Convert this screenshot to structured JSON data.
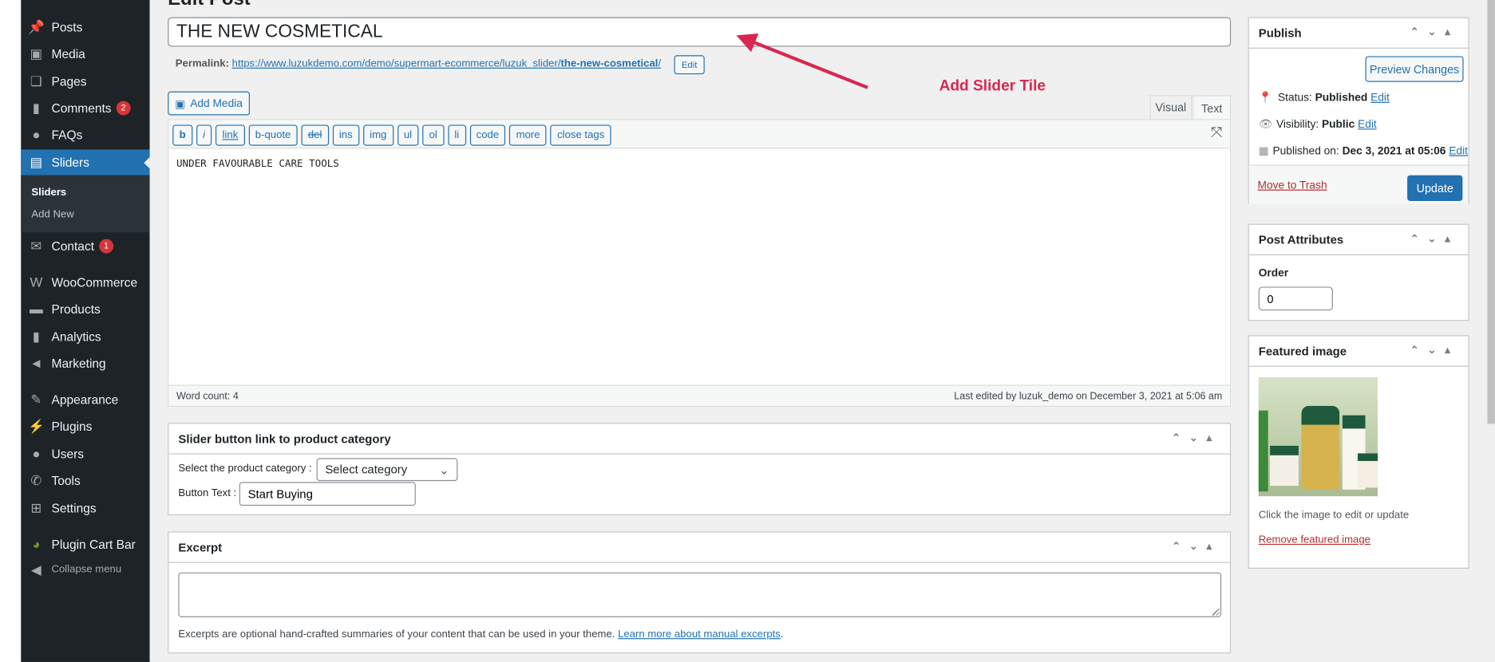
{
  "sidebar": {
    "items": [
      {
        "label": "Posts",
        "icon": "pin-icon"
      },
      {
        "label": "Media",
        "icon": "media-icon"
      },
      {
        "label": "Pages",
        "icon": "pages-icon"
      },
      {
        "label": "Comments",
        "icon": "comment-icon",
        "badge": "2"
      },
      {
        "label": "FAQs",
        "icon": "faq-icon"
      },
      {
        "label": "Sliders",
        "icon": "slider-icon"
      },
      {
        "label": "Contact",
        "icon": "mail-icon",
        "badge": "1"
      },
      {
        "label": "WooCommerce",
        "icon": "woo-icon"
      },
      {
        "label": "Products",
        "icon": "archive-icon"
      },
      {
        "label": "Analytics",
        "icon": "chart-icon"
      },
      {
        "label": "Marketing",
        "icon": "megaphone-icon"
      },
      {
        "label": "Appearance",
        "icon": "brush-icon"
      },
      {
        "label": "Plugins",
        "icon": "plug-icon"
      },
      {
        "label": "Users",
        "icon": "user-icon"
      },
      {
        "label": "Tools",
        "icon": "wrench-icon"
      },
      {
        "label": "Settings",
        "icon": "settings-icon"
      },
      {
        "label": "Plugin Cart Bar",
        "icon": "pie-icon"
      },
      {
        "label": "Collapse menu",
        "icon": "collapse-icon"
      }
    ],
    "submenu": [
      "Sliders",
      "Add New"
    ]
  },
  "post": {
    "title": "THE NEW COSMETICAL",
    "permalink_label": "Permalink:",
    "permalink_base": "https://www.luzukdemo.com/demo/supermart-ecommerce/luzuk_slider/",
    "permalink_slug": "the-new-cosmetical",
    "permalink_end": "/",
    "edit": "Edit"
  },
  "editor": {
    "add_media": "Add Media",
    "tabs": [
      "Visual",
      "Text"
    ],
    "quicktags": [
      "b",
      "i",
      "link",
      "b-quote",
      "del",
      "ins",
      "img",
      "ul",
      "ol",
      "li",
      "code",
      "more",
      "close tags"
    ],
    "content": "UNDER FAVOURABLE CARE TOOLS",
    "word_count": "Word count: 4",
    "last_edited": "Last edited by luzuk_demo on December 3, 2021 at 5:06 am"
  },
  "annotation": {
    "text": "Add Slider Tile",
    "color": "#d8274f"
  },
  "slider_box": {
    "title": "Slider button link to product category",
    "category_label": "Select the product category :",
    "category_value": "Select category",
    "button_label": "Button Text :",
    "button_value": "Start Buying"
  },
  "excerpt": {
    "title": "Excerpt",
    "value": "",
    "help": "Excerpts are optional hand-crafted summaries of your content that can be used in your theme.",
    "help_link": "Learn more about manual excerpts",
    "help_end": "."
  },
  "publish": {
    "title": "Publish",
    "preview": "Preview Changes",
    "status_label": "Status:",
    "status": "Published",
    "visibility_label": "Visibility:",
    "visibility": "Public",
    "published_label": "Published on:",
    "published": "Dec 3, 2021 at 05:06",
    "edit": "Edit",
    "trash": "Move to Trash",
    "update": "Update"
  },
  "attributes": {
    "title": "Post Attributes",
    "order_label": "Order",
    "order": "0"
  },
  "featured": {
    "title": "Featured image",
    "caption": "Click the image to edit or update",
    "remove": "Remove featured image"
  },
  "colors": {
    "accent": "#2271b1",
    "sidebar": "#1d2327",
    "annotation": "#d8274f"
  }
}
